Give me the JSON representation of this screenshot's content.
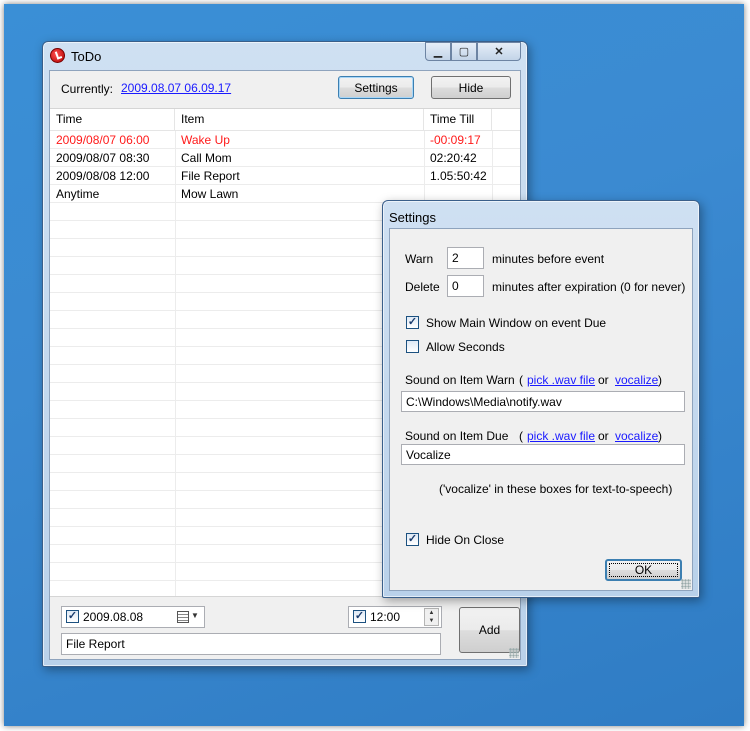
{
  "main_window": {
    "title": "ToDo",
    "caption": {
      "minimize": "▁",
      "maximize": "▢",
      "close": "✕"
    },
    "currently_label": "Currently:",
    "currently_value": "2009.08.07 06.09.17",
    "settings_button": "Settings",
    "hide_button": "Hide",
    "columns": [
      "Time",
      "Item",
      "Time Till"
    ],
    "rows": [
      {
        "time": "2009/08/07  06:00",
        "item": "Wake Up",
        "till": "-00:09:17",
        "overdue": true
      },
      {
        "time": "2009/08/07  08:30",
        "item": "Call Mom",
        "till": "02:20:42",
        "overdue": false
      },
      {
        "time": "2009/08/08  12:00",
        "item": "File Report",
        "till": "1.05:50:42",
        "overdue": false
      },
      {
        "time": "Anytime",
        "item": "Mow Lawn",
        "till": "",
        "overdue": false
      }
    ],
    "date_value": "2009.08.08",
    "date_checked": true,
    "time_value": "12:00",
    "time_checked": true,
    "item_value": "File Report",
    "add_button": "Add",
    "colors": {
      "overdue": "#ff1a1a",
      "link": "#1a1aff"
    }
  },
  "settings_window": {
    "title": "Settings",
    "warn_label": "Warn",
    "warn_value": "2",
    "warn_suffix": "minutes before event",
    "delete_label": "Delete",
    "delete_value": "0",
    "delete_suffix": "minutes after expiration (0 for never)",
    "show_main_label": "Show Main Window on event Due",
    "show_main_checked": true,
    "allow_seconds_label": "Allow Seconds",
    "allow_seconds_checked": false,
    "sound_warn_label": "Sound on Item Warn",
    "sound_warn_value": "C:\\Windows\\Media\\notify.wav",
    "sound_due_label": "Sound on Item Due",
    "sound_due_value": "Vocalize",
    "paren_open": "(",
    "paren_close": ")",
    "pick_wav_link": "pick .wav file",
    "or_text": "or",
    "vocalize_link": "vocalize",
    "hint": "('vocalize' in these boxes for text-to-speech)",
    "hide_on_close_label": "Hide On Close",
    "hide_on_close_checked": true,
    "ok_button": "OK"
  },
  "icons": {
    "app": "todo-app-icon",
    "check": "✓",
    "calendar": "calendar-icon",
    "dropdown": "▼",
    "spin_up": "▲",
    "spin_down": "▼"
  }
}
